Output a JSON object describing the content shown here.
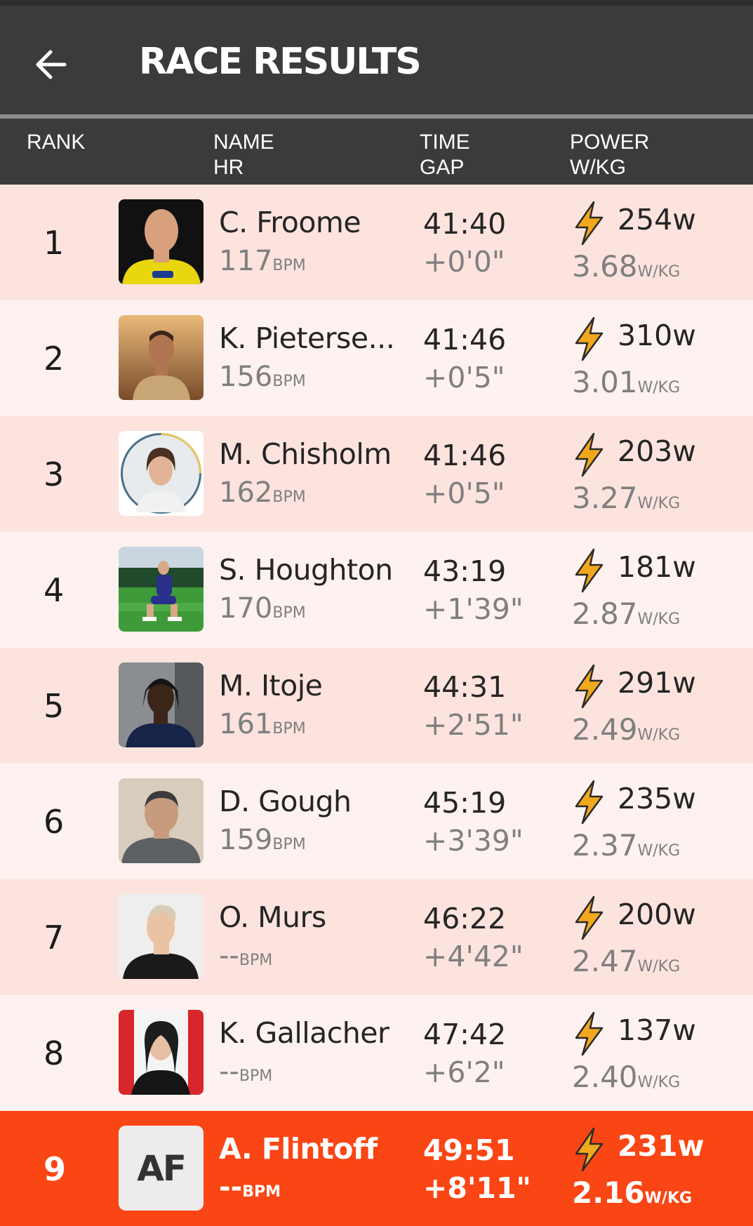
{
  "header": {
    "title": "RACE RESULTS"
  },
  "columns": {
    "rank": "RANK",
    "name": "NAME",
    "hr": "HR",
    "time": "TIME",
    "gap": "GAP",
    "power": "POWER",
    "wkg": "W/KG"
  },
  "units": {
    "bpm": "BPM",
    "wkg": "W/KG"
  },
  "colors": {
    "highlight": "#fa4515",
    "row_odd": "#fde3de",
    "row_even": "#fdf2f0",
    "header": "#3b3b3b",
    "bolt": "#f2a81d"
  },
  "riders": [
    {
      "rank": "1",
      "name": "C. Froome",
      "hr": "117",
      "time": "41:40",
      "gap": "+0'0\"",
      "power": "254w",
      "wkg": "3.68",
      "avatar": "photo-cyclist-yellow-jersey"
    },
    {
      "rank": "2",
      "name": "K. Pieterse...",
      "hr": "156",
      "time": "41:46",
      "gap": "+0'5\"",
      "power": "310w",
      "wkg": "3.01",
      "avatar": "photo-man-sunset"
    },
    {
      "rank": "3",
      "name": "M. Chisholm",
      "hr": "162",
      "time": "41:46",
      "gap": "+0'5\"",
      "power": "203w",
      "wkg": "3.27",
      "avatar": "photo-woman-circle-frame"
    },
    {
      "rank": "4",
      "name": "S. Houghton",
      "hr": "170",
      "time": "43:19",
      "gap": "+1'39\"",
      "power": "181w",
      "wkg": "2.87",
      "avatar": "photo-footballer-pitch"
    },
    {
      "rank": "5",
      "name": "M. Itoje",
      "hr": "161",
      "time": "44:31",
      "gap": "+2'51\"",
      "power": "291w",
      "wkg": "2.49",
      "avatar": "photo-man-braids"
    },
    {
      "rank": "6",
      "name": "D. Gough",
      "hr": "159",
      "time": "45:19",
      "gap": "+3'39\"",
      "power": "235w",
      "wkg": "2.37",
      "avatar": "photo-man-grey-shirt"
    },
    {
      "rank": "7",
      "name": "O. Murs",
      "hr": "--",
      "time": "46:22",
      "gap": "+4'42\"",
      "power": "200w",
      "wkg": "2.47",
      "avatar": "photo-man-smiling"
    },
    {
      "rank": "8",
      "name": "K. Gallacher",
      "hr": "--",
      "time": "47:42",
      "gap": "+6'2\"",
      "power": "137w",
      "wkg": "2.40",
      "avatar": "photo-woman-red-carpet"
    },
    {
      "rank": "9",
      "name": "A. Flintoff",
      "hr": "--",
      "time": "49:51",
      "gap": "+8'11\"",
      "power": "231w",
      "wkg": "2.16",
      "initials": "AF",
      "highlight": true
    }
  ]
}
